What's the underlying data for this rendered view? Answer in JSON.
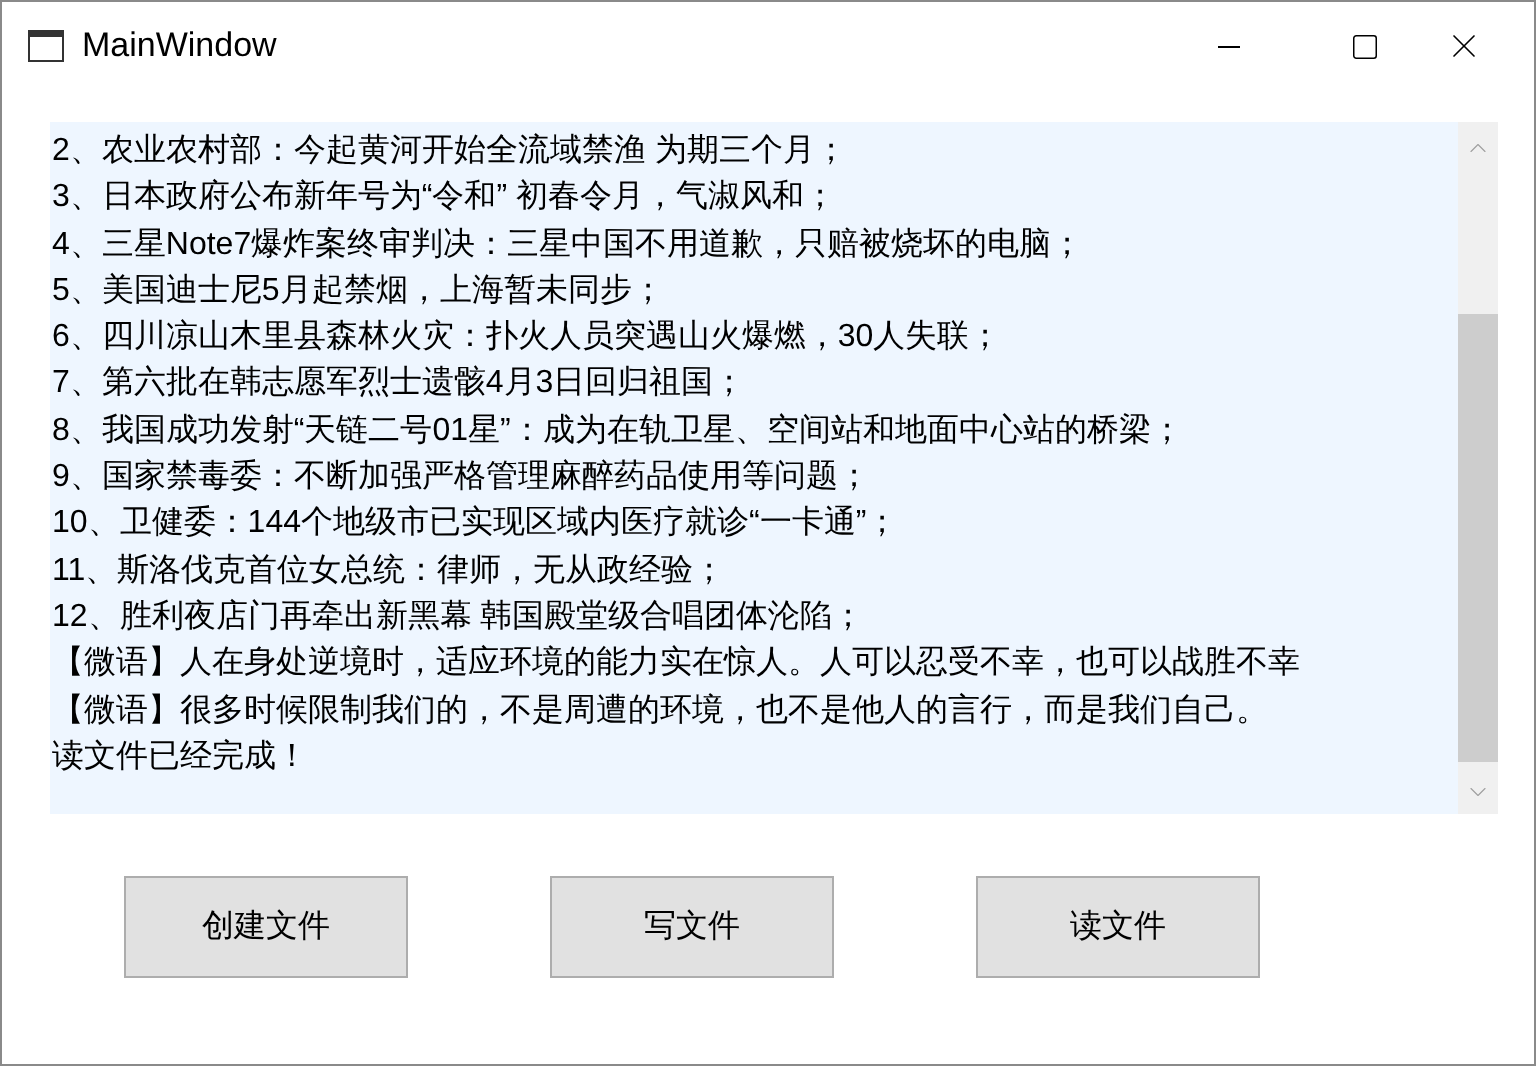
{
  "window": {
    "title": "MainWindow"
  },
  "text_area": {
    "lines": [
      "2、农业农村部：今起黄河开始全流域禁渔 为期三个月；",
      "3、日本政府公布新年号为“令和” 初春令月，气淑风和；",
      "4、三星Note7爆炸案终审判决：三星中国不用道歉，只赔被烧坏的电脑；",
      "5、美国迪士尼5月起禁烟，上海暂未同步；",
      "6、四川凉山木里县森林火灾：扑火人员突遇山火爆燃，30人失联；",
      "7、第六批在韩志愿军烈士遗骸4月3日回归祖国；",
      "8、我国成功发射“天链二号01星”：成为在轨卫星、空间站和地面中心站的桥梁；",
      "9、国家禁毒委：不断加强严格管理麻醉药品使用等问题；",
      "10、卫健委：144个地级市已实现区域内医疗就诊“一卡通”；",
      "11、斯洛伐克首位女总统：律师，无从政经验；",
      "12、胜利夜店门再牵出新黑幕  韩国殿堂级合唱团体沦陷；",
      "【微语】人在身处逆境时，适应环境的能力实在惊人。人可以忍受不幸，也可以战胜不幸",
      "【微语】很多时候限制我们的，不是周遭的环境，也不是他人的言行，而是我们自己。",
      "读文件已经完成！"
    ]
  },
  "buttons": [
    "创建文件",
    "写文件",
    "读文件"
  ]
}
